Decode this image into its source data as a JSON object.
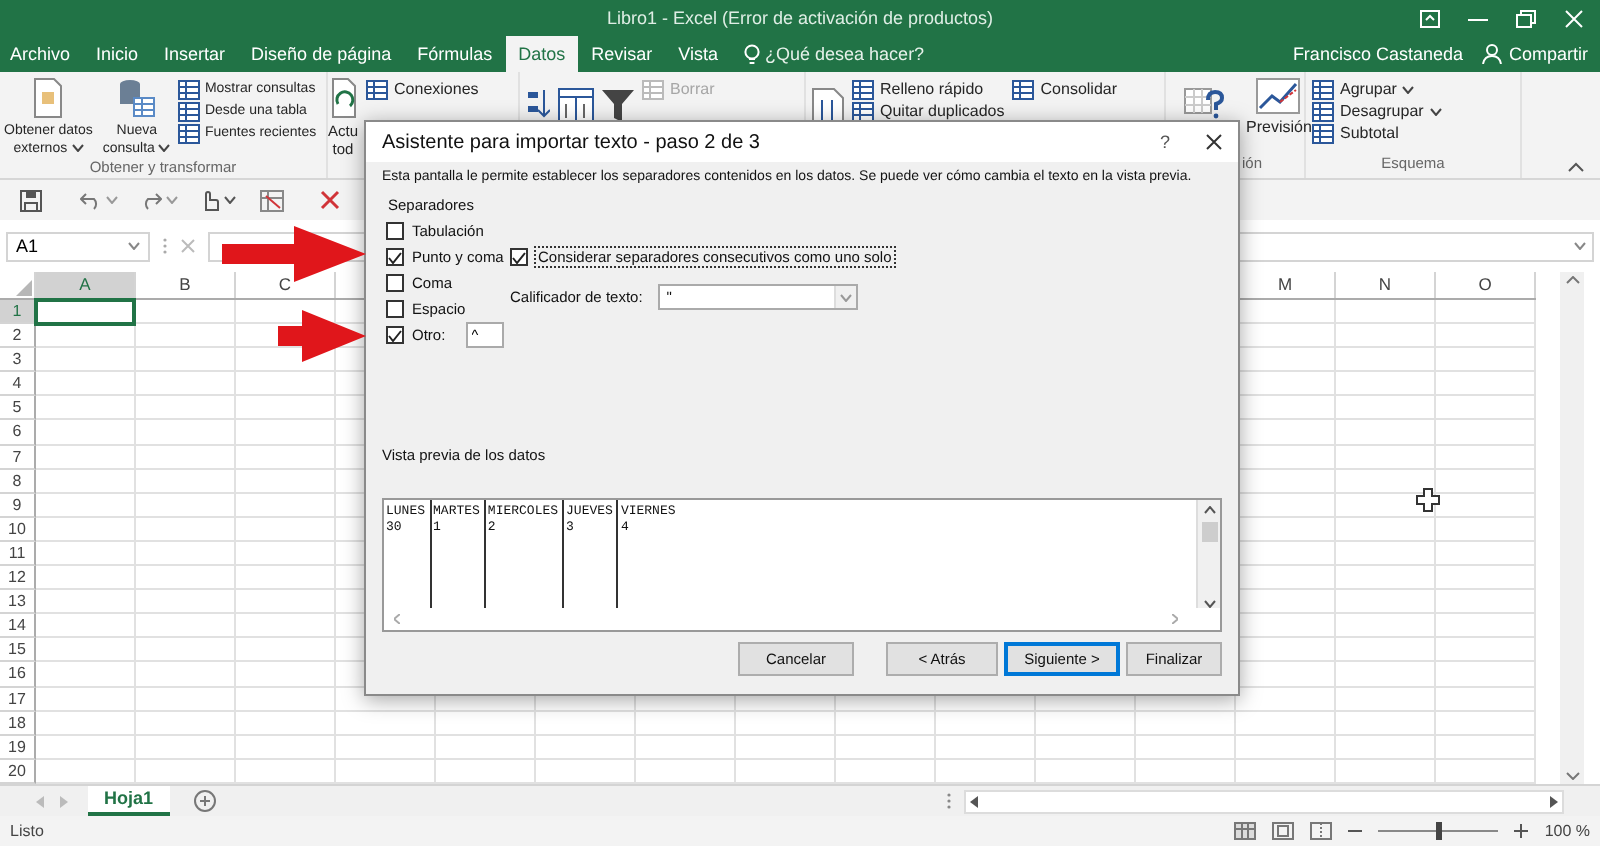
{
  "window": {
    "title": "Libro1 - Excel (Error de activación de productos)"
  },
  "ribbon_tabs": [
    {
      "label": "Archivo",
      "selected": false
    },
    {
      "label": "Inicio",
      "selected": false
    },
    {
      "label": "Insertar",
      "selected": false
    },
    {
      "label": "Diseño de página",
      "selected": false
    },
    {
      "label": "Fórmulas",
      "selected": false
    },
    {
      "label": "Datos",
      "selected": true
    },
    {
      "label": "Revisar",
      "selected": false
    },
    {
      "label": "Vista",
      "selected": false
    }
  ],
  "tell_me": {
    "placeholder": "¿Qué desea hacer?"
  },
  "account": {
    "user": "Francisco Castaneda",
    "share": "Compartir"
  },
  "ribbon_groups": [
    {
      "label": "Obtener y transformar",
      "items": [
        {
          "kind": "large",
          "lines": [
            "Obtener datos",
            "externos"
          ],
          "dropdown": true
        },
        {
          "kind": "large",
          "lines": [
            "Nueva",
            "consulta"
          ],
          "dropdown": true
        },
        {
          "kind": "stack",
          "entries": [
            {
              "label": "Mostrar consultas",
              "disabled": false,
              "dropdown": false
            },
            {
              "label": "Desde una tabla",
              "disabled": false,
              "dropdown": false
            },
            {
              "label": "Fuentes recientes",
              "disabled": false,
              "dropdown": false
            }
          ]
        }
      ]
    },
    {
      "items": [
        {
          "kind": "large",
          "lines": [
            "Actu",
            "tod"
          ],
          "dropdown": false
        },
        {
          "kind": "stack",
          "entries": [
            {
              "label": "Conexiones",
              "disabled": false,
              "dropdown": false
            }
          ]
        }
      ]
    },
    {
      "items": [
        {
          "kind": "icon"
        },
        {
          "kind": "icon"
        },
        {
          "kind": "icon"
        },
        {
          "kind": "stack",
          "entries": [
            {
              "label": "Borrar",
              "disabled": true,
              "dropdown": false
            }
          ]
        }
      ]
    },
    {
      "items": [
        {
          "kind": "icon"
        },
        {
          "kind": "stack",
          "entries": [
            {
              "label": "Relleno rápido",
              "disabled": false,
              "dropdown": false
            },
            {
              "label": "Quitar duplicados",
              "disabled": false,
              "dropdown": false
            }
          ]
        },
        {
          "kind": "stack",
          "entries": [
            {
              "label": "Consolidar",
              "disabled": false,
              "dropdown": false
            }
          ]
        }
      ]
    },
    {
      "label": "ión",
      "items": [
        {
          "kind": "icon"
        },
        {
          "kind": "large",
          "lines": [
            "Previsión"
          ],
          "dropdown": false
        }
      ]
    },
    {
      "label": "Esquema",
      "items": [
        {
          "kind": "stack",
          "entries": [
            {
              "label": "Agrupar",
              "disabled": false,
              "dropdown": true
            },
            {
              "label": "Desagrupar",
              "disabled": false,
              "dropdown": true
            },
            {
              "label": "Subtotal",
              "disabled": false,
              "dropdown": false
            }
          ]
        }
      ]
    }
  ],
  "formula_bar": {
    "name_box": "A1"
  },
  "grid": {
    "columns_left": [
      {
        "label": "A",
        "selected": true
      },
      {
        "label": "B",
        "selected": false
      },
      {
        "label": "C",
        "selected": false
      }
    ],
    "columns_right": [
      {
        "label": "M",
        "selected": false
      },
      {
        "label": "N",
        "selected": false
      },
      {
        "label": "O",
        "selected": false
      }
    ],
    "rows": [
      {
        "label": "1",
        "selected": true
      },
      {
        "label": "2",
        "selected": false
      },
      {
        "label": "3",
        "selected": false
      },
      {
        "label": "4",
        "selected": false
      },
      {
        "label": "5",
        "selected": false
      },
      {
        "label": "6",
        "selected": false
      },
      {
        "label": "7",
        "selected": false
      },
      {
        "label": "8",
        "selected": false
      },
      {
        "label": "9",
        "selected": false
      },
      {
        "label": "10",
        "selected": false
      },
      {
        "label": "11",
        "selected": false
      },
      {
        "label": "12",
        "selected": false
      },
      {
        "label": "13",
        "selected": false
      },
      {
        "label": "14",
        "selected": false
      },
      {
        "label": "15",
        "selected": false
      },
      {
        "label": "16",
        "selected": false
      },
      {
        "label": "17",
        "selected": false
      },
      {
        "label": "18",
        "selected": false
      },
      {
        "label": "19",
        "selected": false
      },
      {
        "label": "20",
        "selected": false
      }
    ]
  },
  "sheet_tabs": [
    {
      "label": "Hoja1",
      "selected": true
    }
  ],
  "status_bar": {
    "status": "Listo",
    "zoom": "100 %",
    "zoom_slider": {
      "level": 0.5
    }
  },
  "dialog": {
    "title": "Asistente para importar texto - paso 2 de 3",
    "help": "?",
    "description": "Esta pantalla le permite establecer los separadores contenidos en los datos. Se puede ver cómo cambia el texto en la vista previa.",
    "separators": {
      "title": "Separadores",
      "options": [
        {
          "label": "Tabulación",
          "checked": false
        },
        {
          "label": "Punto y coma",
          "checked": true
        },
        {
          "label": "Coma",
          "checked": false
        },
        {
          "label": "Espacio",
          "checked": false
        },
        {
          "label": "Otro:",
          "checked": true,
          "value": "^"
        }
      ]
    },
    "consecutive": {
      "label": "Considerar separadores consecutivos como uno solo",
      "checked": true
    },
    "text_qualifier": {
      "label": "Calificador de texto:",
      "value": "\""
    },
    "preview": {
      "title": "Vista previa de los datos",
      "columns": [
        {
          "lines": [
            "LUNES",
            "30"
          ]
        },
        {
          "lines": [
            "MARTES",
            "1"
          ]
        },
        {
          "lines": [
            "MIERCOLES",
            "2"
          ]
        },
        {
          "lines": [
            "JUEVES",
            "3"
          ]
        },
        {
          "lines": [
            "VIERNES",
            "4"
          ]
        }
      ]
    },
    "buttons": [
      {
        "label": "Cancelar",
        "default": false
      },
      {
        "label": "< Atrás",
        "default": false
      },
      {
        "label": "Siguiente >",
        "default": true
      },
      {
        "label": "Finalizar",
        "default": false
      }
    ]
  }
}
